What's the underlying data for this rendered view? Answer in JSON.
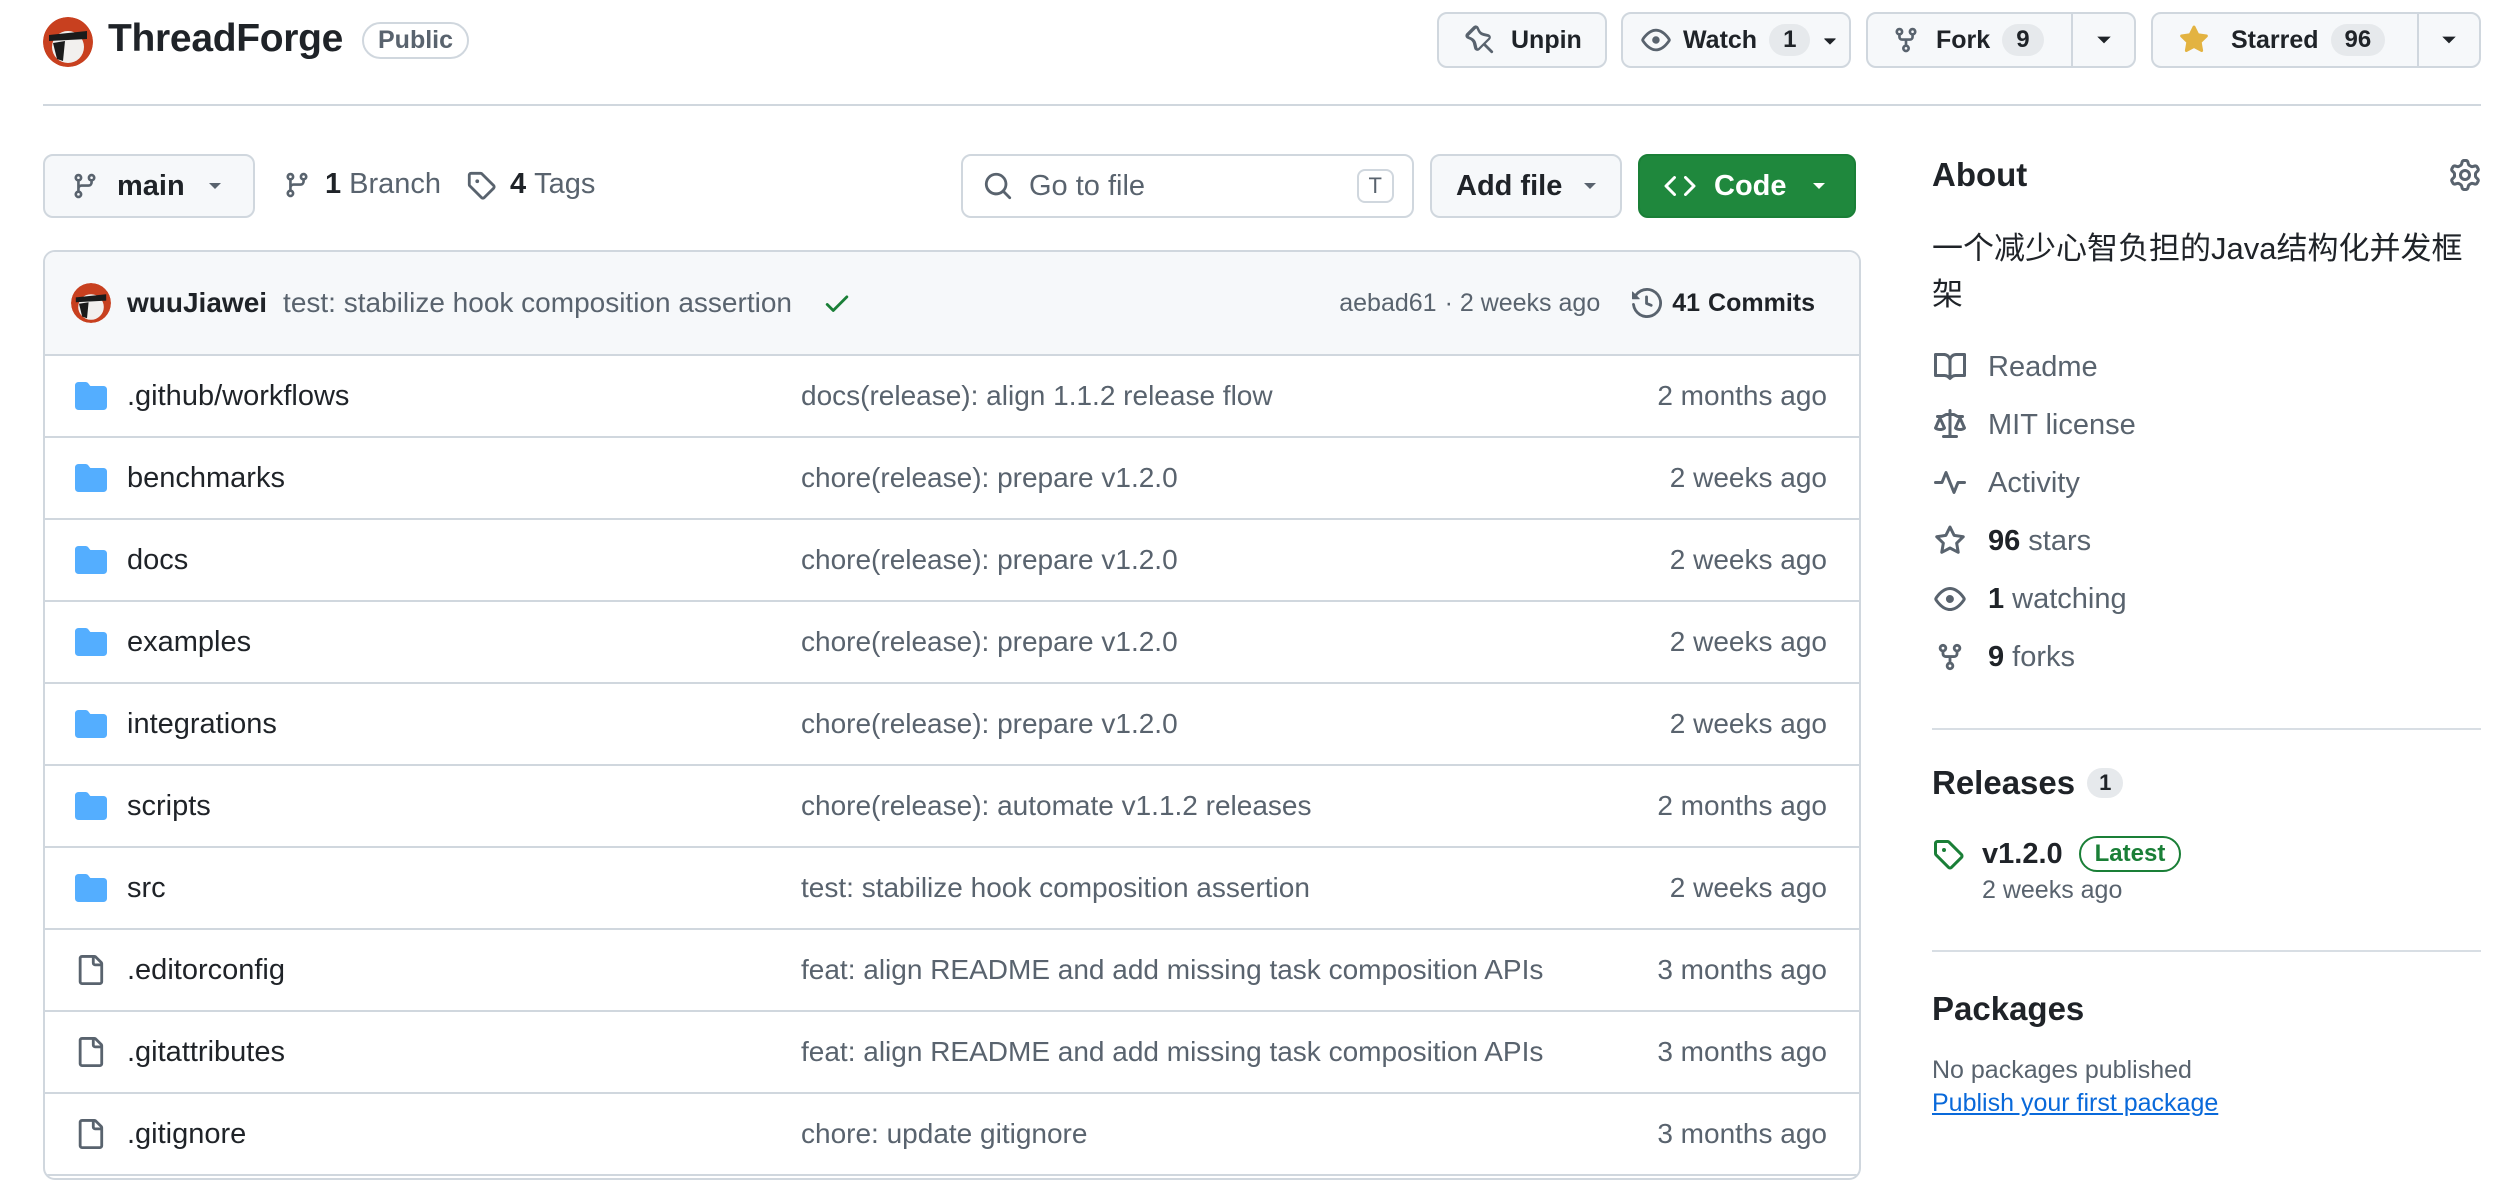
{
  "repo": {
    "name": "ThreadForge",
    "visibility": "Public"
  },
  "header_actions": {
    "unpin_label": "Unpin",
    "watch_label": "Watch",
    "watch_count": "1",
    "fork_label": "Fork",
    "fork_count": "9",
    "star_label": "Starred",
    "star_count": "96"
  },
  "toolbar": {
    "branch": "main",
    "branches_count": "1",
    "branches_label": "Branch",
    "tags_count": "4",
    "tags_label": "Tags",
    "search_placeholder": "Go to file",
    "search_shortcut": "T",
    "add_file_label": "Add file",
    "code_label": "Code"
  },
  "latest_commit": {
    "author": "wuuJiawei",
    "message": "test: stabilize hook composition assertion",
    "sha": "aebad61",
    "time": "· 2 weeks ago",
    "commits_count": "41",
    "commits_label": "Commits"
  },
  "files": [
    {
      "name": ".github/workflows",
      "type": "dir",
      "message": "docs(release): align 1.1.2 release flow",
      "date": "2 months ago"
    },
    {
      "name": "benchmarks",
      "type": "dir",
      "message": "chore(release): prepare v1.2.0",
      "date": "2 weeks ago"
    },
    {
      "name": "docs",
      "type": "dir",
      "message": "chore(release): prepare v1.2.0",
      "date": "2 weeks ago"
    },
    {
      "name": "examples",
      "type": "dir",
      "message": "chore(release): prepare v1.2.0",
      "date": "2 weeks ago"
    },
    {
      "name": "integrations",
      "type": "dir",
      "message": "chore(release): prepare v1.2.0",
      "date": "2 weeks ago"
    },
    {
      "name": "scripts",
      "type": "dir",
      "message": "chore(release): automate v1.1.2 releases",
      "date": "2 months ago"
    },
    {
      "name": "src",
      "type": "dir",
      "message": "test: stabilize hook composition assertion",
      "date": "2 weeks ago"
    },
    {
      "name": ".editorconfig",
      "type": "file",
      "message": "feat: align README and add missing task composition APIs",
      "date": "3 months ago"
    },
    {
      "name": ".gitattributes",
      "type": "file",
      "message": "feat: align README and add missing task composition APIs",
      "date": "3 months ago"
    },
    {
      "name": ".gitignore",
      "type": "file",
      "message": "chore: update gitignore",
      "date": "3 months ago"
    }
  ],
  "about": {
    "title": "About",
    "description": "一个减少心智负担的Java结构化并发框架",
    "readme": "Readme",
    "license": "MIT license",
    "activity": "Activity",
    "stars_count": "96",
    "stars_label": "stars",
    "watching_count": "1",
    "watching_label": "watching",
    "forks_count": "9",
    "forks_label": "forks"
  },
  "releases": {
    "title": "Releases",
    "count": "1",
    "latest_tag": "v1.2.0",
    "latest_badge": "Latest",
    "latest_time": "2 weeks ago"
  },
  "packages": {
    "title": "Packages",
    "empty_text": "No packages published",
    "publish_link": "Publish your first package"
  },
  "colors": {
    "accent_green": "#1f883d",
    "link_blue": "#0969da",
    "folder_blue": "#54aeff",
    "star_yellow": "#e3b341"
  }
}
